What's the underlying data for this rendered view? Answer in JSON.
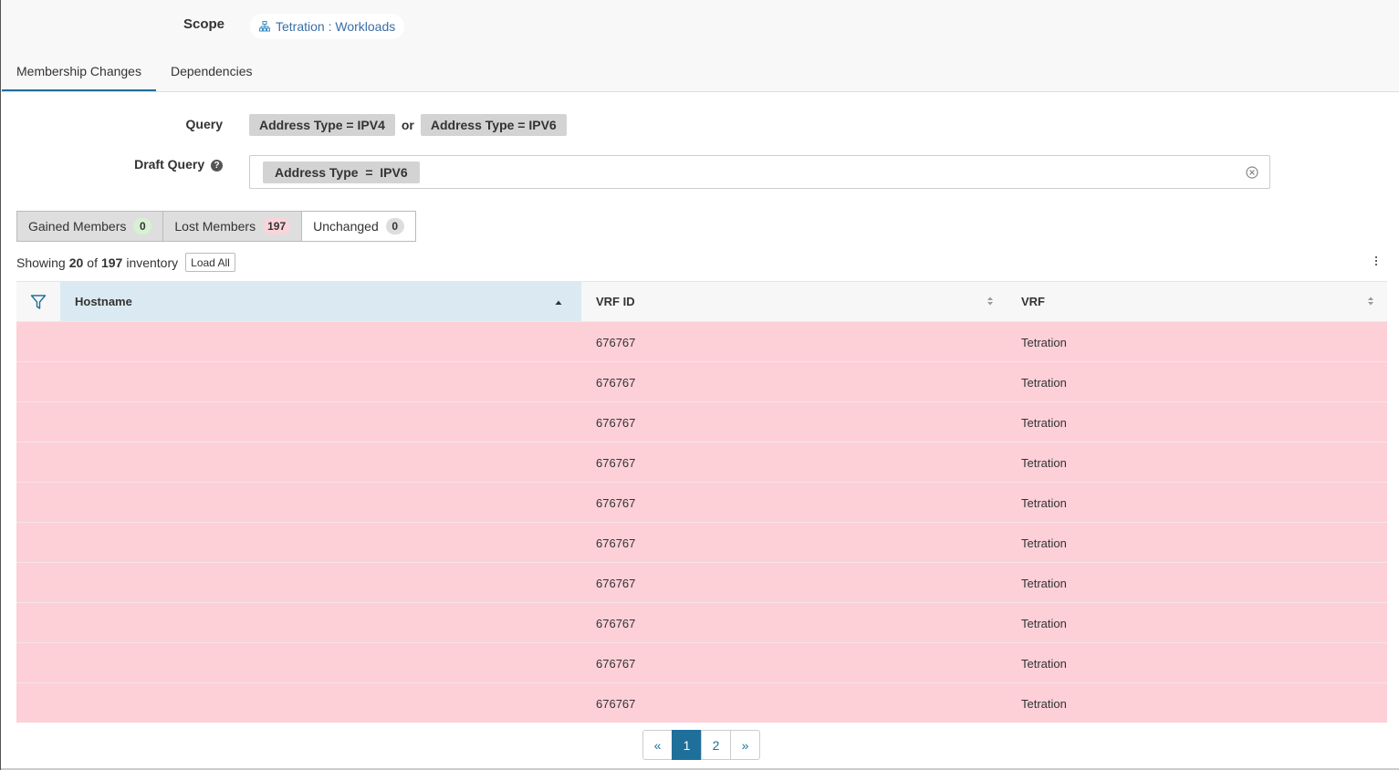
{
  "scope": {
    "label": "Scope",
    "value": "Tetration : Workloads",
    "icon": "hierarchy-icon"
  },
  "tabs": [
    {
      "label": "Membership Changes",
      "active": true
    },
    {
      "label": "Dependencies",
      "active": false
    }
  ],
  "query": {
    "label": "Query",
    "chips": [
      "Address Type = IPV4",
      "Address Type = IPV6"
    ],
    "joiner": "or"
  },
  "draft_query": {
    "label": "Draft Query",
    "help_glyph": "?",
    "chip": "Address Type  =  IPV6"
  },
  "segments": [
    {
      "label": "Gained Members",
      "count": "0"
    },
    {
      "label": "Lost Members",
      "count": "197"
    },
    {
      "label": "Unchanged",
      "count": "0"
    }
  ],
  "showing": {
    "prefix": "Showing",
    "shown": "20",
    "of": "of",
    "total": "197",
    "suffix": "inventory",
    "load_all": "Load All"
  },
  "table": {
    "columns": [
      "Hostname",
      "VRF ID",
      "VRF"
    ],
    "rows": [
      {
        "hostname": "",
        "vrf_id": "676767",
        "vrf": "Tetration"
      },
      {
        "hostname": "",
        "vrf_id": "676767",
        "vrf": "Tetration"
      },
      {
        "hostname": "",
        "vrf_id": "676767",
        "vrf": "Tetration"
      },
      {
        "hostname": "",
        "vrf_id": "676767",
        "vrf": "Tetration"
      },
      {
        "hostname": "",
        "vrf_id": "676767",
        "vrf": "Tetration"
      },
      {
        "hostname": "",
        "vrf_id": "676767",
        "vrf": "Tetration"
      },
      {
        "hostname": "",
        "vrf_id": "676767",
        "vrf": "Tetration"
      },
      {
        "hostname": "",
        "vrf_id": "676767",
        "vrf": "Tetration"
      },
      {
        "hostname": "",
        "vrf_id": "676767",
        "vrf": "Tetration"
      },
      {
        "hostname": "",
        "vrf_id": "676767",
        "vrf": "Tetration"
      }
    ]
  },
  "pagination": {
    "prev": "«",
    "pages": [
      "1",
      "2"
    ],
    "next": "»",
    "current": "1"
  },
  "colors": {
    "accent": "#1f6f9b",
    "lost_row": "#fdd0d8",
    "sorted_header": "#dbeaf2"
  }
}
